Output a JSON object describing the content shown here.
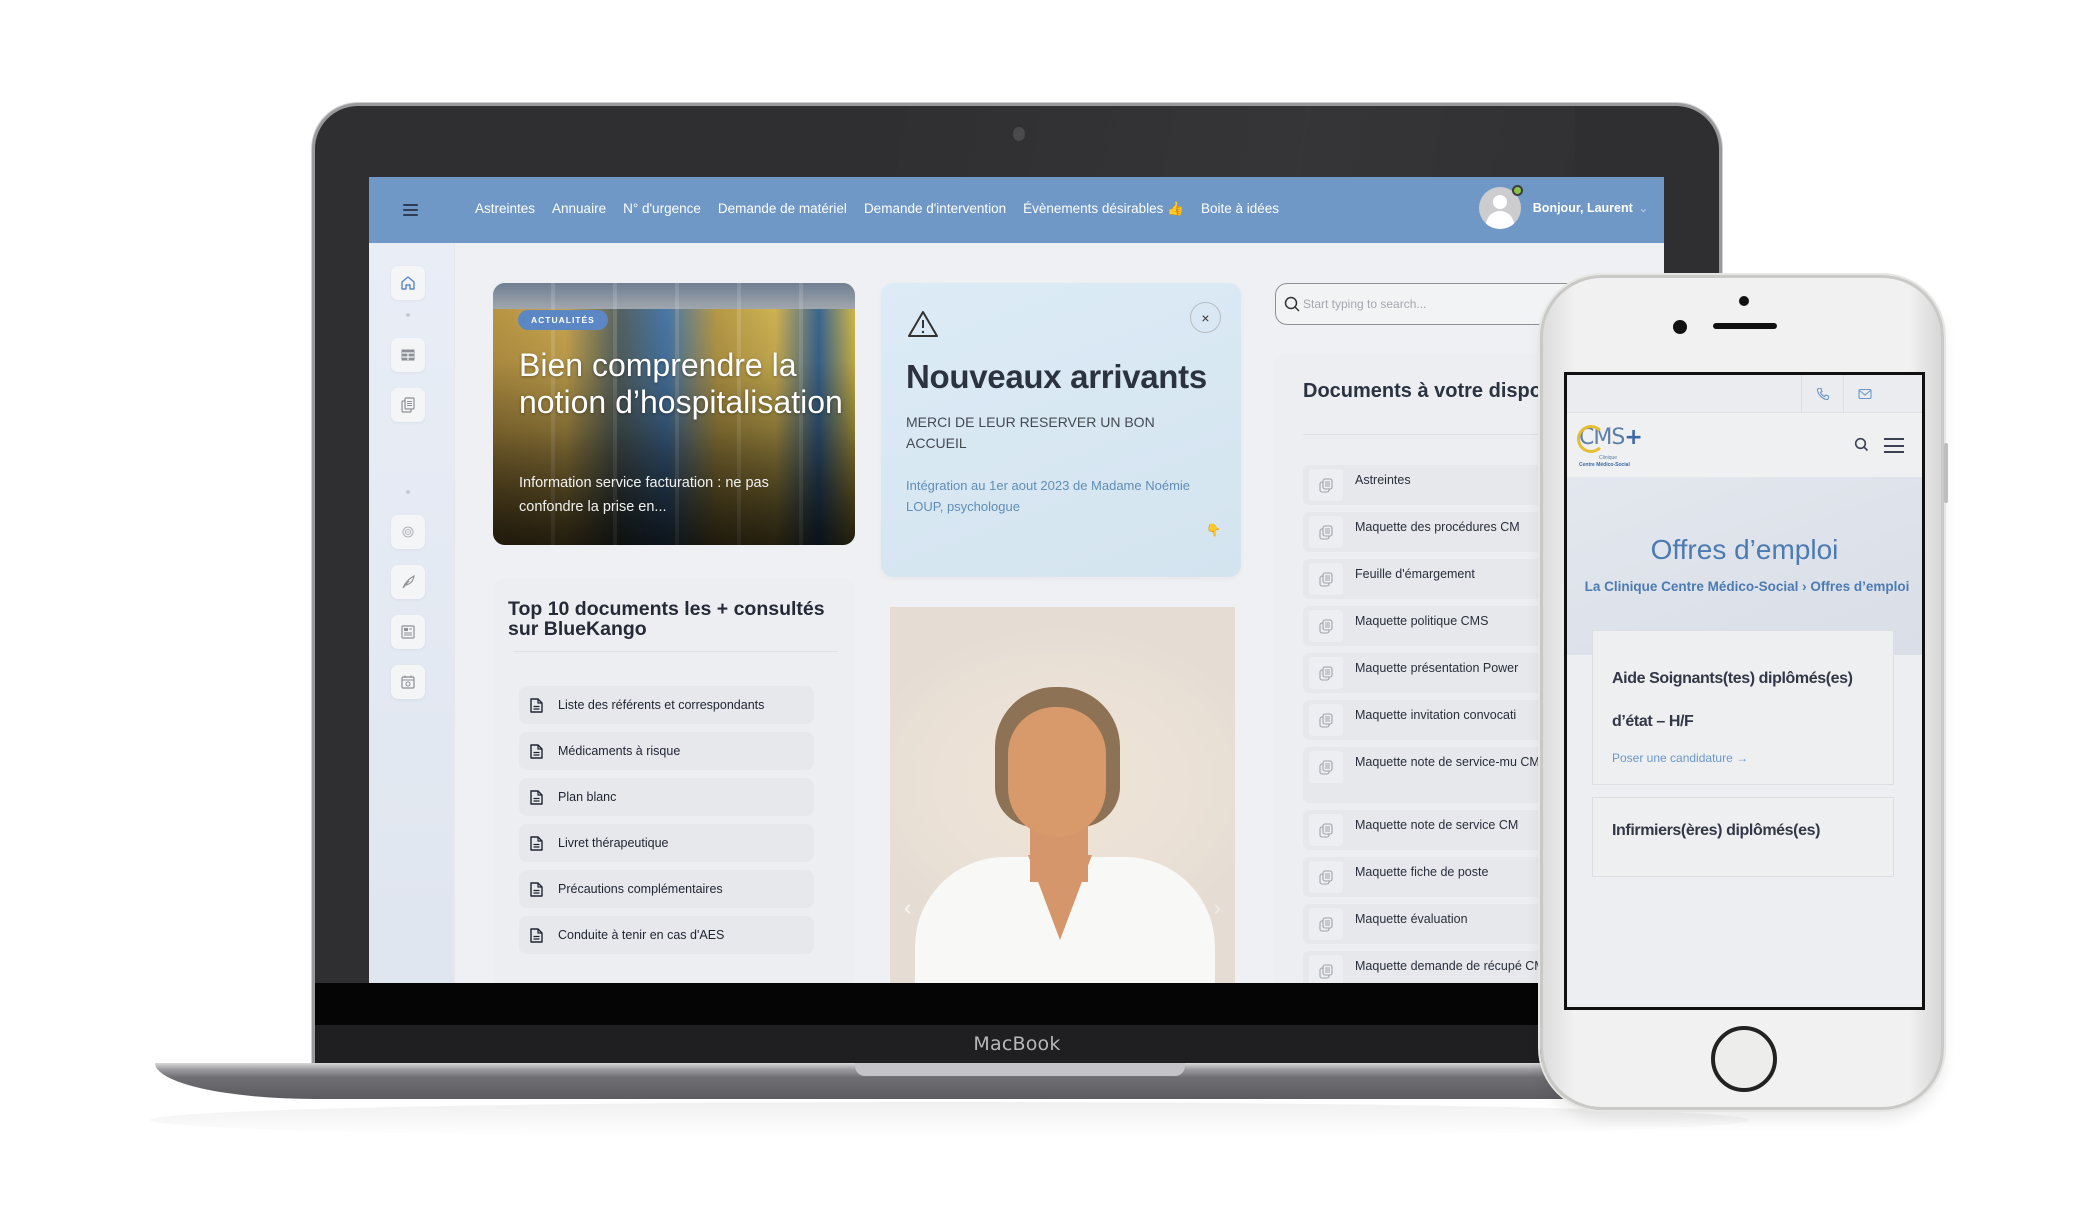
{
  "laptop": {
    "brand_label": "MacBook",
    "nav": {
      "links": [
        "Astreintes",
        "Annuaire",
        "N° d'urgence",
        "Demande de matériel",
        "Demande d'intervention",
        "Évènements désirables 👍",
        "Boite à idées"
      ],
      "greeting": "Bonjour,  Laurent",
      "caret": "⌄",
      "user_online": true
    },
    "sidebar": {
      "items": [
        {
          "icon": "home-icon",
          "active": true
        },
        {
          "icon": "table-icon"
        },
        {
          "icon": "documents-icon"
        },
        {
          "icon": "target-icon"
        },
        {
          "icon": "feather-icon"
        },
        {
          "icon": "newspaper-icon"
        },
        {
          "icon": "calendar-icon"
        }
      ]
    },
    "news_card": {
      "badge": "ACTUALITÉS",
      "title": "Bien comprendre la notion d’hospitalisation",
      "excerpt": "Information service facturation : ne pas confondre la prise en..."
    },
    "arrivals_card": {
      "title": "Nouveaux arrivants",
      "subtitle": "MERCI DE LEUR RESERVER UN BON ACCUEIL",
      "description": "Intégration au 1er aout 2023 de Madame Noémie LOUP, psychologue",
      "emoji": "👇",
      "close_label": "×"
    },
    "top10": {
      "title": "Top 10 documents les + consultés sur BlueKango",
      "items": [
        "Liste des référents et correspondants",
        "Médicaments à risque",
        "Plan blanc",
        "Livret thérapeutique",
        "Précautions complémentaires",
        "Conduite à tenir en cas d'AES"
      ]
    },
    "carousel": {
      "prev": "‹",
      "next": "›"
    },
    "search": {
      "placeholder": "Start typing to search..."
    },
    "documents": {
      "title": "Documents à votre dispo",
      "items": [
        "Astreintes",
        "Maquette des procédures CM",
        "Feuille d'émargement",
        "Maquette politique CMS",
        "Maquette présentation Power",
        "Maquette invitation convocati",
        "Maquette note de service-mu CMS",
        "Maquette note de service CM",
        "Maquette fiche de poste",
        "Maquette évaluation",
        "Maquette demande de récupé CMS"
      ]
    }
  },
  "phone": {
    "logo": {
      "text": "CMS",
      "plus": "+",
      "line1": "Clinique",
      "line2": "Centre Médico-Social"
    },
    "hero": {
      "title": "Offres d’emploi",
      "breadcrumb": "La Clinique Centre Médico-Social  ›  Offres d’emploi"
    },
    "jobs": [
      {
        "title": "Aide Soignants(tes) diplômés(es) d’état – H/F",
        "cta": "Poser une candidature →"
      },
      {
        "title": "Infirmiers(ères) diplômés(es)"
      }
    ]
  },
  "colors": {
    "nav_blue": "#6f98c7",
    "accent_blue": "#4c7bb3",
    "link_blue": "#5f8eb7",
    "online_green": "#8bc34a"
  }
}
